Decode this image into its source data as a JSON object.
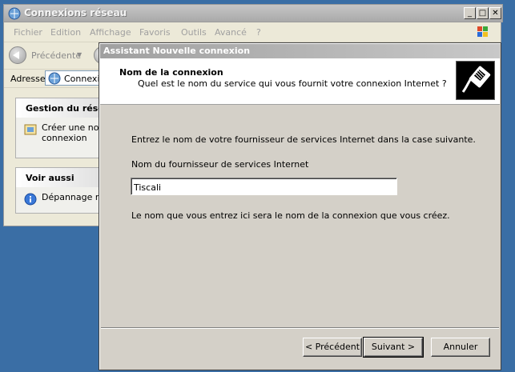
{
  "explorer": {
    "title": "Connexions réseau",
    "menu": [
      "Fichier",
      "Edition",
      "Affichage",
      "Favoris",
      "Outils",
      "Avancé",
      "?"
    ],
    "toolbar": {
      "back_label": "Précédente"
    },
    "address": {
      "label": "Adresse",
      "value": "Connexio"
    },
    "task_panel": {
      "title": "Gestion du résea",
      "items": [
        {
          "line1": "Créer une nou",
          "line2": "connexion"
        }
      ]
    },
    "see_also_panel": {
      "title": "Voir aussi",
      "items": [
        {
          "label": "Dépannage ré"
        }
      ]
    }
  },
  "wizard": {
    "title": "Assistant Nouvelle connexion",
    "header_title": "Nom de la connexion",
    "header_subtitle": "Quel est le nom du service qui vous fournit votre connexion Internet ?",
    "instruction": "Entrez le nom de votre fournisseur de services Internet dans la case suivante.",
    "field_label": "Nom du fournisseur de services Internet",
    "field_value": "Tiscali",
    "note": "Le nom que vous entrez ici sera le nom de la connexion que vous créez.",
    "buttons": {
      "back": "< Précédent",
      "next": "Suivant >",
      "cancel": "Annuler"
    }
  },
  "window_controls": {
    "minimize": "_",
    "maximize": "□",
    "close": "✕"
  },
  "colors": {
    "desktop": "#3a6ea5",
    "dialog_face": "#d4d0c8"
  },
  "icons": {
    "explorer_title": "network-folder-icon",
    "windows_logo": "windows-flag-icon",
    "back": "back-arrow-icon",
    "address": "network-folder-icon",
    "task_item": "new-connection-icon",
    "see_also_item": "info-icon",
    "wizard_header": "phone-connector-icon"
  }
}
